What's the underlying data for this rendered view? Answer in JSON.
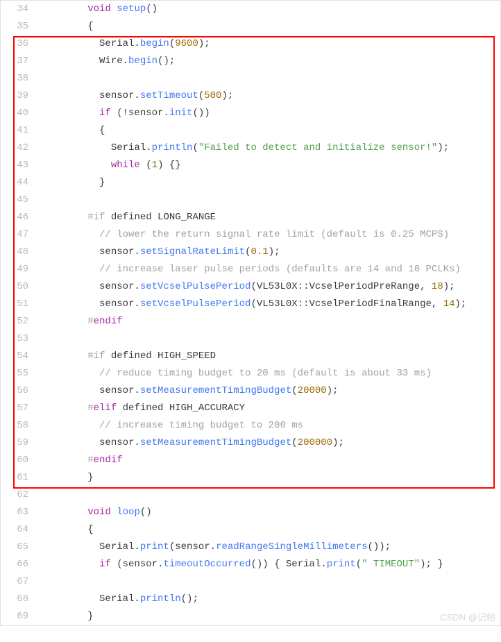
{
  "watermark": "CSDN @记帖",
  "lines": [
    {
      "n": 34,
      "tokens": [
        {
          "t": "        "
        },
        {
          "t": "void",
          "c": "kw"
        },
        {
          "t": " "
        },
        {
          "t": "setup",
          "c": "fn"
        },
        {
          "t": "()"
        }
      ]
    },
    {
      "n": 35,
      "tokens": [
        {
          "t": "        {"
        }
      ]
    },
    {
      "n": 36,
      "tokens": [
        {
          "t": "          Serial."
        },
        {
          "t": "begin",
          "c": "fn"
        },
        {
          "t": "("
        },
        {
          "t": "9600",
          "c": "num"
        },
        {
          "t": ");"
        }
      ]
    },
    {
      "n": 37,
      "tokens": [
        {
          "t": "          Wire."
        },
        {
          "t": "begin",
          "c": "fn"
        },
        {
          "t": "();"
        }
      ]
    },
    {
      "n": 38,
      "tokens": [
        {
          "t": ""
        }
      ]
    },
    {
      "n": 39,
      "tokens": [
        {
          "t": "          sensor."
        },
        {
          "t": "setTimeout",
          "c": "fn"
        },
        {
          "t": "("
        },
        {
          "t": "500",
          "c": "num"
        },
        {
          "t": ");"
        }
      ]
    },
    {
      "n": 40,
      "tokens": [
        {
          "t": "          "
        },
        {
          "t": "if",
          "c": "kw"
        },
        {
          "t": " (!sensor."
        },
        {
          "t": "init",
          "c": "fn"
        },
        {
          "t": "())"
        }
      ]
    },
    {
      "n": 41,
      "tokens": [
        {
          "t": "          {"
        }
      ]
    },
    {
      "n": 42,
      "tokens": [
        {
          "t": "            Serial."
        },
        {
          "t": "println",
          "c": "fn"
        },
        {
          "t": "("
        },
        {
          "t": "\"Failed to detect and initialize sensor!\"",
          "c": "str"
        },
        {
          "t": ");"
        }
      ]
    },
    {
      "n": 43,
      "tokens": [
        {
          "t": "            "
        },
        {
          "t": "while",
          "c": "kw"
        },
        {
          "t": " ("
        },
        {
          "t": "1",
          "c": "num"
        },
        {
          "t": ") {}"
        }
      ]
    },
    {
      "n": 44,
      "tokens": [
        {
          "t": "          }"
        }
      ]
    },
    {
      "n": 45,
      "tokens": [
        {
          "t": ""
        }
      ]
    },
    {
      "n": 46,
      "tokens": [
        {
          "t": "        "
        },
        {
          "t": "#if",
          "c": "pp"
        },
        {
          "t": " defined LONG_RANGE"
        }
      ]
    },
    {
      "n": 47,
      "tokens": [
        {
          "t": "          "
        },
        {
          "t": "// lower the return signal rate limit (default is 0.25 MCPS)",
          "c": "cmt"
        }
      ]
    },
    {
      "n": 48,
      "tokens": [
        {
          "t": "          sensor."
        },
        {
          "t": "setSignalRateLimit",
          "c": "fn"
        },
        {
          "t": "("
        },
        {
          "t": "0.1",
          "c": "num"
        },
        {
          "t": ");"
        }
      ]
    },
    {
      "n": 49,
      "tokens": [
        {
          "t": "          "
        },
        {
          "t": "// increase laser pulse periods (defaults are 14 and 10 PCLKs)",
          "c": "cmt"
        }
      ]
    },
    {
      "n": 50,
      "tokens": [
        {
          "t": "          sensor."
        },
        {
          "t": "setVcselPulsePeriod",
          "c": "fn"
        },
        {
          "t": "(VL53L0X::VcselPeriodPreRange, "
        },
        {
          "t": "18",
          "c": "num"
        },
        {
          "t": ");"
        }
      ]
    },
    {
      "n": 51,
      "tokens": [
        {
          "t": "          sensor."
        },
        {
          "t": "setVcselPulsePeriod",
          "c": "fn"
        },
        {
          "t": "(VL53L0X::VcselPeriodFinalRange, "
        },
        {
          "t": "14",
          "c": "num"
        },
        {
          "t": ");"
        }
      ]
    },
    {
      "n": 52,
      "tokens": [
        {
          "t": "        "
        },
        {
          "t": "#",
          "c": "pp"
        },
        {
          "t": "endif",
          "c": "pp-kw"
        }
      ]
    },
    {
      "n": 53,
      "tokens": [
        {
          "t": ""
        }
      ]
    },
    {
      "n": 54,
      "tokens": [
        {
          "t": "        "
        },
        {
          "t": "#if",
          "c": "pp"
        },
        {
          "t": " defined HIGH_SPEED"
        }
      ]
    },
    {
      "n": 55,
      "tokens": [
        {
          "t": "          "
        },
        {
          "t": "// reduce timing budget to 20 ms (default is about 33 ms)",
          "c": "cmt"
        }
      ]
    },
    {
      "n": 56,
      "tokens": [
        {
          "t": "          sensor."
        },
        {
          "t": "setMeasurementTimingBudget",
          "c": "fn"
        },
        {
          "t": "("
        },
        {
          "t": "20000",
          "c": "num"
        },
        {
          "t": ");"
        }
      ]
    },
    {
      "n": 57,
      "tokens": [
        {
          "t": "        "
        },
        {
          "t": "#",
          "c": "pp"
        },
        {
          "t": "elif",
          "c": "pp-kw"
        },
        {
          "t": " defined HIGH_ACCURACY"
        }
      ]
    },
    {
      "n": 58,
      "tokens": [
        {
          "t": "          "
        },
        {
          "t": "// increase timing budget to 200 ms",
          "c": "cmt"
        }
      ]
    },
    {
      "n": 59,
      "tokens": [
        {
          "t": "          sensor."
        },
        {
          "t": "setMeasurementTimingBudget",
          "c": "fn"
        },
        {
          "t": "("
        },
        {
          "t": "200000",
          "c": "num"
        },
        {
          "t": ");"
        }
      ]
    },
    {
      "n": 60,
      "tokens": [
        {
          "t": "        "
        },
        {
          "t": "#",
          "c": "pp"
        },
        {
          "t": "endif",
          "c": "pp-kw"
        }
      ]
    },
    {
      "n": 61,
      "tokens": [
        {
          "t": "        }"
        }
      ]
    },
    {
      "n": 62,
      "tokens": [
        {
          "t": ""
        }
      ]
    },
    {
      "n": 63,
      "tokens": [
        {
          "t": "        "
        },
        {
          "t": "void",
          "c": "kw"
        },
        {
          "t": " "
        },
        {
          "t": "loop",
          "c": "fn"
        },
        {
          "t": "()"
        }
      ]
    },
    {
      "n": 64,
      "tokens": [
        {
          "t": "        {"
        }
      ]
    },
    {
      "n": 65,
      "tokens": [
        {
          "t": "          Serial."
        },
        {
          "t": "print",
          "c": "fn"
        },
        {
          "t": "(sensor."
        },
        {
          "t": "readRangeSingleMillimeters",
          "c": "fn"
        },
        {
          "t": "());"
        }
      ]
    },
    {
      "n": 66,
      "tokens": [
        {
          "t": "          "
        },
        {
          "t": "if",
          "c": "kw"
        },
        {
          "t": " (sensor."
        },
        {
          "t": "timeoutOccurred",
          "c": "fn"
        },
        {
          "t": "()) { Serial."
        },
        {
          "t": "print",
          "c": "fn"
        },
        {
          "t": "("
        },
        {
          "t": "\" TIMEOUT\"",
          "c": "str"
        },
        {
          "t": "); }"
        }
      ]
    },
    {
      "n": 67,
      "tokens": [
        {
          "t": ""
        }
      ]
    },
    {
      "n": 68,
      "tokens": [
        {
          "t": "          Serial."
        },
        {
          "t": "println",
          "c": "fn"
        },
        {
          "t": "();"
        }
      ]
    },
    {
      "n": 69,
      "tokens": [
        {
          "t": "        }"
        }
      ]
    }
  ]
}
